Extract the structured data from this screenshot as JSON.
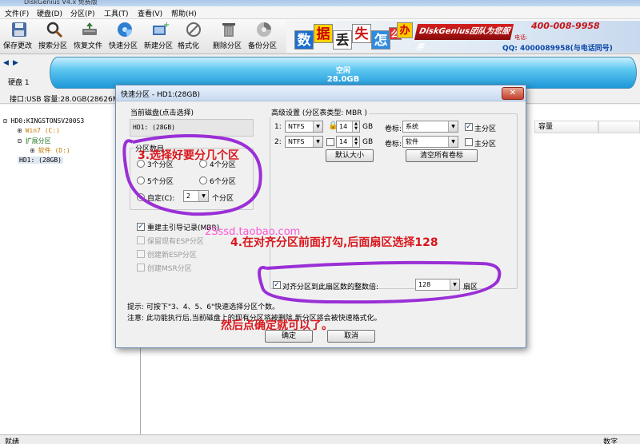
{
  "window": {
    "title": "DiskGenius V4.x 免费版"
  },
  "menu": [
    "文件(F)",
    "硬盘(D)",
    "分区(P)",
    "工具(T)",
    "查看(V)",
    "帮助(H)"
  ],
  "toolbar": [
    "保存更改",
    "搜索分区",
    "恢复文件",
    "快速分区",
    "新建分区",
    "格式化",
    "删除分区",
    "备份分区"
  ],
  "banner": {
    "chars": [
      "数",
      "据",
      "丢",
      "失",
      "怎",
      "么",
      "办"
    ],
    "brand": "DiskGenius团队为您服务",
    "tel_label": "电话:",
    "tel": "400-008-9958",
    "qq": "QQ: 4000089958(与电话同号)"
  },
  "diskbar": {
    "disk_label": "硬盘 1",
    "interface": "接口:USB  容量:28.0GB(28626MB)",
    "volume_label": "空闲",
    "volume_size": "28.0GB"
  },
  "tree": {
    "items": [
      "HD0:KINGSTONSV200S3",
      "Win7 (C:)",
      "扩展分区",
      "软件 (D:)",
      "HD1: (28GB)"
    ]
  },
  "columns": {
    "capacity": "容量"
  },
  "dialog": {
    "title": "快速分区 - HD1:(28GB)",
    "current_disk_label": "当前磁盘(点击选择)",
    "current_disk_value": "HD1: (28GB)",
    "partition_count_label": "分区数目",
    "options": [
      "3个分区",
      "4个分区",
      "5个分区",
      "6个分区"
    ],
    "custom_label": "自定(C):",
    "custom_value": "2",
    "custom_unit": "个分区",
    "mbr_label": "重建主引导记录(MBR)",
    "keep_esp": "保留现有ESP分区",
    "create_esp": "创建新ESP分区",
    "create_msr": "创建MSR分区",
    "advanced_label": "高级设置 (分区表类型: MBR )",
    "partitions": [
      {
        "index": "1:",
        "fs": "NTFS",
        "size": "14",
        "unit": "GB",
        "vol_label": "卷标:",
        "name": "系统",
        "primary": "主分区"
      },
      {
        "index": "2:",
        "fs": "NTFS",
        "size": "14",
        "unit": "GB",
        "vol_label": "卷标:",
        "name": "软件",
        "primary": "主分区"
      }
    ],
    "default_size_button": "默认大小",
    "clear_labels_button": "清空所有卷标",
    "align_label": "对齐分区到此扇区数的整数倍:",
    "align_value": "128",
    "align_unit": "扇区",
    "hint": "提示: 可按下\"3、4、5、6\"快速选择分区个数。",
    "note": "注意: 此功能执行后,当前磁盘上的现有分区将被删除,新分区将会被快速格式化。",
    "ok_button": "确定",
    "cancel_button": "取消"
  },
  "annotations": {
    "step3": "3.选择好要分几个区",
    "step4": "4.在对齐分区前面打勾,后面扇区选择128",
    "final": "然后点确定就可以了。",
    "watermark": "2Sssd.taobao.com"
  },
  "status": {
    "left": "就绪",
    "right": "数字"
  }
}
